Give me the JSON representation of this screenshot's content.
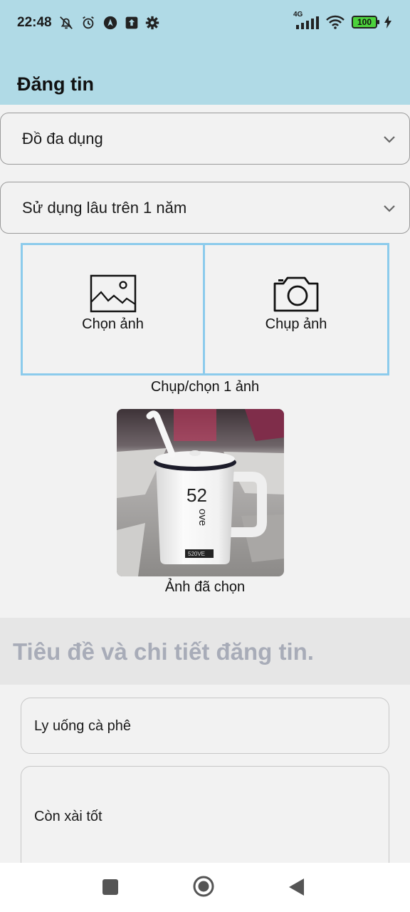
{
  "status_bar": {
    "time": "22:48",
    "network": "4G",
    "battery": "100"
  },
  "header": {
    "title": "Đăng tin"
  },
  "dropdowns": {
    "category": "Đồ đa dụng",
    "condition": "Sử dụng lâu trên 1 năm"
  },
  "photo_picker": {
    "choose_label": "Chọn ảnh",
    "capture_label": "Chụp ảnh",
    "hint": "Chụp/chọn 1 ảnh"
  },
  "selected_image": {
    "caption": "Ảnh đã chọn",
    "mug_text_top": "52",
    "mug_text_side": "ove",
    "mug_text_bottom": "520VE"
  },
  "details": {
    "section_title": "Tiêu đề và chi tiết đăng tin.",
    "title_value": "Ly uống cà phê",
    "description_value": "Còn xài tốt"
  },
  "colors": {
    "header_bg": "#b0dae6",
    "picker_border": "#8ccbec",
    "section_title": "#a8acb8"
  },
  "icons": [
    "silent-bell-icon",
    "alarm-icon",
    "navigation-icon",
    "upload-icon",
    "settings-icon",
    "signal-icon",
    "wifi-icon",
    "battery-icon",
    "charging-icon",
    "chevron-down-icon",
    "image-icon",
    "camera-icon",
    "recent-apps-icon",
    "home-icon",
    "back-icon"
  ]
}
